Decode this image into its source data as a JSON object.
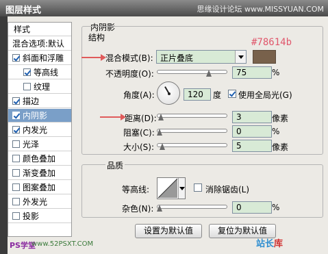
{
  "window": {
    "title": "图层样式",
    "watermark": "思缘设计论坛 www.MISSYUAN.COM"
  },
  "sidebar": {
    "header": "样式",
    "blend_options": "混合选项:默认",
    "items": [
      {
        "label": "斜面和浮雕",
        "checked": true,
        "indent": false,
        "selected": false
      },
      {
        "label": "等高线",
        "checked": true,
        "indent": true,
        "selected": false
      },
      {
        "label": "纹理",
        "checked": false,
        "indent": true,
        "selected": false
      },
      {
        "label": "描边",
        "checked": true,
        "indent": false,
        "selected": false
      },
      {
        "label": "内阴影",
        "checked": true,
        "indent": false,
        "selected": true
      },
      {
        "label": "内发光",
        "checked": true,
        "indent": false,
        "selected": false
      },
      {
        "label": "光泽",
        "checked": false,
        "indent": false,
        "selected": false
      },
      {
        "label": "颜色叠加",
        "checked": false,
        "indent": false,
        "selected": false
      },
      {
        "label": "渐变叠加",
        "checked": false,
        "indent": false,
        "selected": false
      },
      {
        "label": "图案叠加",
        "checked": false,
        "indent": false,
        "selected": false
      },
      {
        "label": "外发光",
        "checked": false,
        "indent": false,
        "selected": false
      },
      {
        "label": "投影",
        "checked": false,
        "indent": false,
        "selected": false
      }
    ]
  },
  "panel": {
    "title": "内阴影",
    "structure": {
      "label": "结构",
      "blend_mode_label": "混合模式(B):",
      "blend_mode_value": "正片叠底",
      "color_note": "#78614b",
      "color": "#78614b",
      "opacity_label": "不透明度(O):",
      "opacity_value": "75",
      "opacity_unit": "%",
      "angle_label": "角度(A):",
      "angle_value": "120",
      "angle_unit": "度",
      "global_light_label": "使用全局光(G)",
      "global_light_checked": true,
      "distance_label": "距离(D):",
      "distance_value": "3",
      "distance_unit": "像素",
      "choke_label": "阻塞(C):",
      "choke_value": "0",
      "choke_unit": "%",
      "size_label": "大小(S):",
      "size_value": "5",
      "size_unit": "像素"
    },
    "quality": {
      "label": "品质",
      "contour_label": "等高线:",
      "antialias_label": "消除锯齿(L)",
      "antialias_checked": false,
      "noise_label": "杂色(N):",
      "noise_value": "0",
      "noise_unit": "%"
    },
    "buttons": {
      "make_default": "设置为默认值",
      "reset_default": "复位为默认值"
    }
  },
  "footer": {
    "brand_left": "PS学堂",
    "site_left": "www.52PSXT.COM",
    "logo_text": "站长",
    "logo_mark": "库"
  }
}
